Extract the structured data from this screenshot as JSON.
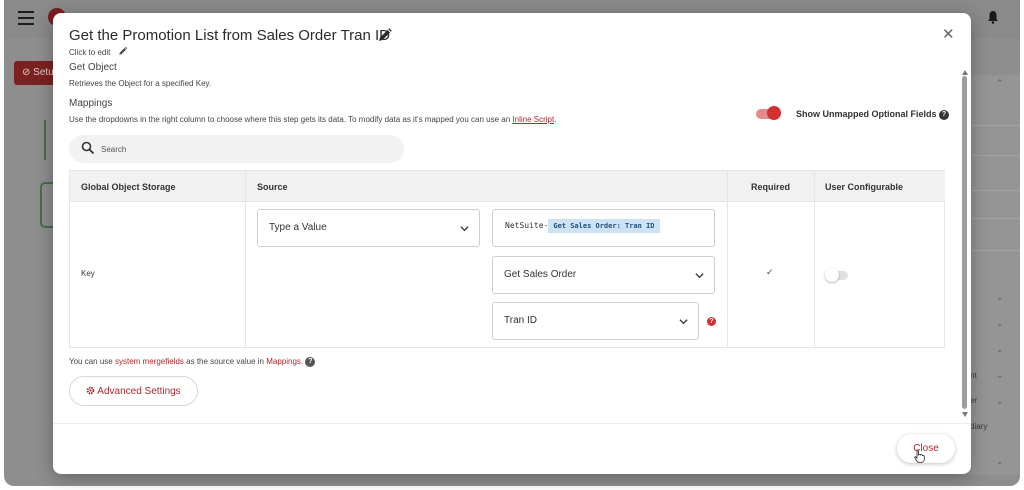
{
  "background": {
    "setup_label": "Setu",
    "panel_texts": [
      "nt",
      "er",
      "diary"
    ]
  },
  "modal": {
    "title": "Get the Promotion List from Sales Order Tran ID",
    "click_to_edit": "Click to edit",
    "section_title": "Get Object",
    "section_desc": "Retrieves the Object for a specified Key.",
    "mappings_title": "Mappings",
    "mappings_desc": "Use the dropdowns in the right column to choose where this step gets its data. To modify data as it's mapped you can use an",
    "inline_script_link": "Inline Script",
    "period": ".",
    "show_unmapped_label": "Show Unmapped Optional Fields",
    "search_placeholder": "Search",
    "table": {
      "headers": [
        "Global Object Storage",
        "Source",
        "Required",
        "User Configurable"
      ],
      "row_key": "Key",
      "source_select": "Type a Value",
      "value_prefix": "NetSuite-",
      "value_token": "Get Sales Order: Tran ID",
      "step_select": "Get Sales Order",
      "field_select": "Tran ID",
      "required_mark": "✓"
    },
    "merge_note_prefix": "You can use",
    "merge_link": "system mergefields",
    "merge_note_middle": "as the source value in",
    "merge_link2": "Mappings",
    "advanced_settings": "Advanced Settings",
    "close_button": "Close"
  },
  "colors": {
    "accent": "#b0282c",
    "toggle_on": "#d32f2f",
    "token_bg": "#cde3f5"
  }
}
